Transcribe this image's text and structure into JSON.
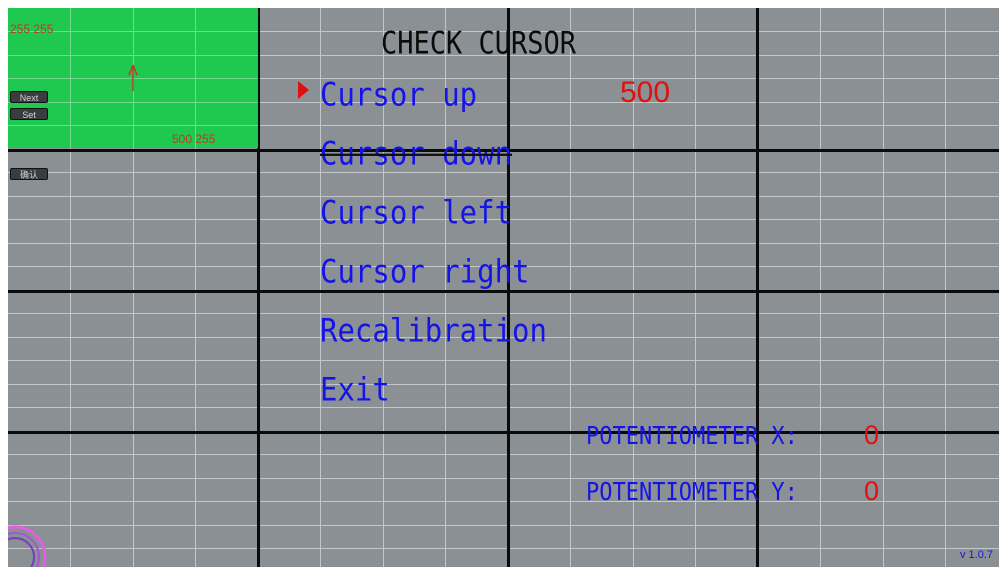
{
  "preview": {
    "top_left_coords": "255 255",
    "bottom_right_coords": "500 255",
    "next_label": "Next",
    "set_label": "Set",
    "side_button_label": "确认"
  },
  "title": "CHECK CURSOR",
  "menu": {
    "selected_index": 0,
    "items": [
      {
        "label": "Cursor up"
      },
      {
        "label": "Cursor down"
      },
      {
        "label": "Cursor left"
      },
      {
        "label": "Cursor right"
      },
      {
        "label": "Recalibration"
      },
      {
        "label": "Exit"
      }
    ],
    "selected_value": "500"
  },
  "potentiometers": {
    "x_label": "POTENTIOMETER X:",
    "x_value": "0",
    "y_label": "POTENTIOMETER Y:",
    "y_value": "0"
  },
  "version": "v 1.0.7",
  "colors": {
    "background": "#8b9094",
    "preview_green": "#1fc84f",
    "menu_blue": "#1414e8",
    "accent_red": "#e01010"
  }
}
